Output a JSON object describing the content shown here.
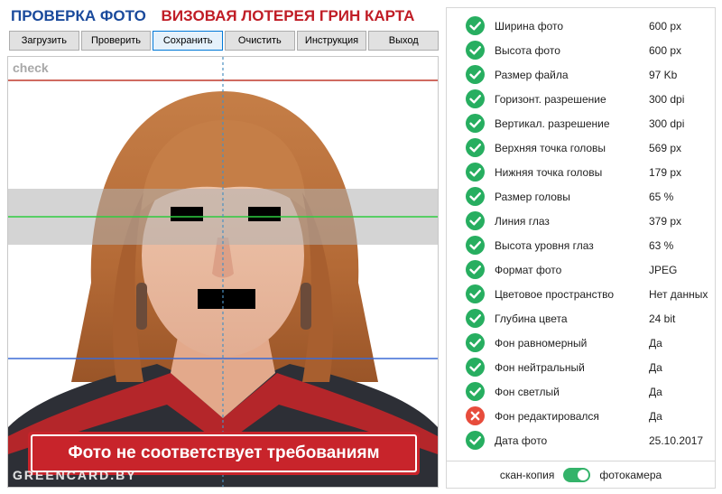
{
  "header": {
    "title_left": "ПРОВЕРКА ФОТО",
    "title_right": "ВИЗОВАЯ ЛОТЕРЕЯ ГРИН КАРТА"
  },
  "toolbar": {
    "buttons": [
      {
        "label": "Загрузить",
        "name": "load-button"
      },
      {
        "label": "Проверить",
        "name": "check-button"
      },
      {
        "label": "Сохранить",
        "name": "save-button"
      },
      {
        "label": "Очистить",
        "name": "clear-button"
      },
      {
        "label": "Инструкция",
        "name": "instruction-button"
      },
      {
        "label": "Выход",
        "name": "exit-button"
      }
    ],
    "active_index": 2
  },
  "photo": {
    "overlay_label": "check",
    "status_message": "Фото не соответствует требованиям",
    "watermark": "GREENCARD.BY"
  },
  "checks": [
    {
      "label": "Ширина фото",
      "value": "600 px",
      "ok": true
    },
    {
      "label": "Высота фото",
      "value": "600 px",
      "ok": true
    },
    {
      "label": "Размер файла",
      "value": "97 Kb",
      "ok": true
    },
    {
      "label": "Горизонт. разрешение",
      "value": "300 dpi",
      "ok": true
    },
    {
      "label": "Вертикал. разрешение",
      "value": "300 dpi",
      "ok": true
    },
    {
      "label": "Верхняя точка головы",
      "value": "569 px",
      "ok": true
    },
    {
      "label": "Нижняя точка головы",
      "value": "179 px",
      "ok": true
    },
    {
      "label": "Размер головы",
      "value": "65 %",
      "ok": true
    },
    {
      "label": "Линия глаз",
      "value": "379 px",
      "ok": true
    },
    {
      "label": "Высота уровня глаз",
      "value": "63 %",
      "ok": true
    },
    {
      "label": "Формат фото",
      "value": "JPEG",
      "ok": true
    },
    {
      "label": "Цветовое пространство",
      "value": "Нет данных",
      "ok": true
    },
    {
      "label": "Глубина цвета",
      "value": "24 bit",
      "ok": true
    },
    {
      "label": "Фон равномерный",
      "value": "Да",
      "ok": true
    },
    {
      "label": "Фон нейтральный",
      "value": "Да",
      "ok": true
    },
    {
      "label": "Фон светлый",
      "value": "Да",
      "ok": true
    },
    {
      "label": "Фон редактировался",
      "value": "Да",
      "ok": false
    },
    {
      "label": "Дата фото",
      "value": "25.10.2017",
      "ok": true
    }
  ],
  "source_toggle": {
    "left_label": "скан-копия",
    "right_label": "фотокамера",
    "on": true
  },
  "colors": {
    "ok": "#27ae60",
    "fail": "#e74c3c",
    "title_blue": "#1a4a9c",
    "title_red": "#c01d26",
    "banner": "#c8242b"
  },
  "icons": {
    "ok": "check-circle-icon",
    "fail": "cross-circle-icon"
  }
}
